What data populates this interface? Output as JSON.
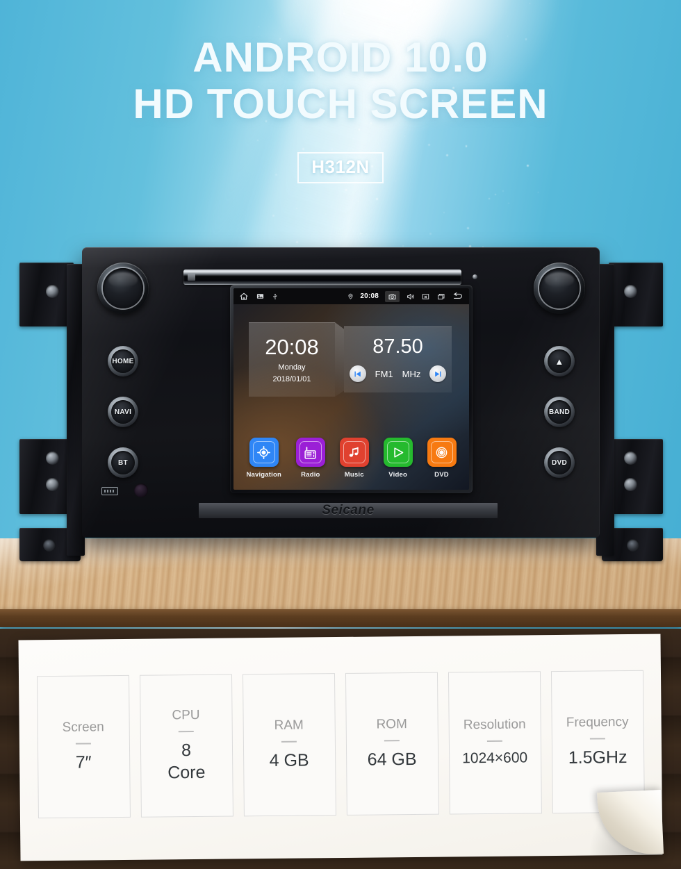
{
  "hero": {
    "line1": "ANDROID 10.0",
    "line2": "HD TOUCH SCREEN",
    "model_badge": "H312N"
  },
  "device": {
    "brand": "Seicane",
    "left_buttons": [
      {
        "name": "volume-knob",
        "label": ""
      },
      {
        "name": "home",
        "label": "HOME"
      },
      {
        "name": "navi",
        "label": "NAVI"
      },
      {
        "name": "bt",
        "label": "BT"
      }
    ],
    "right_buttons": [
      {
        "name": "tune-knob",
        "label": ""
      },
      {
        "name": "eject",
        "label": "▲"
      },
      {
        "name": "band",
        "label": "BAND"
      },
      {
        "name": "dvd",
        "label": "DVD"
      }
    ],
    "screen": {
      "statusbar": {
        "left_icons": [
          "home-icon",
          "image-icon",
          "usb-icon"
        ],
        "location_icon": "location-pin-icon",
        "time": "20:08",
        "right_icons": [
          "camera-icon",
          "volume-icon",
          "close-icon",
          "recents-icon",
          "back-icon"
        ]
      },
      "clock_widget": {
        "time": "20:08",
        "weekday": "Monday",
        "date": "2018/01/01"
      },
      "radio_widget": {
        "frequency": "87.50",
        "band": "FM1",
        "unit": "MHz",
        "prev_label": "prev-station-button",
        "next_label": "next-station-button"
      },
      "apps": [
        {
          "label": "Navigation",
          "color": "#2f86f6",
          "icon": "navigation-target-icon"
        },
        {
          "label": "Radio",
          "color": "#9b1fd6",
          "icon": "radio-icon"
        },
        {
          "label": "Music",
          "color": "#e0412f",
          "icon": "music-note-icon"
        },
        {
          "label": "Video",
          "color": "#25ba2e",
          "icon": "video-play-icon"
        },
        {
          "label": "DVD",
          "color": "#f77a11",
          "icon": "dvd-disc-icon"
        }
      ]
    }
  },
  "specs": [
    {
      "label": "Screen",
      "value": "7″"
    },
    {
      "label": "CPU",
      "value": "8\nCore"
    },
    {
      "label": "RAM",
      "value": "4 GB"
    },
    {
      "label": "ROM",
      "value": "64 GB"
    },
    {
      "label": "Resolution",
      "value": "1024×600"
    },
    {
      "label": "Frequency",
      "value": "1.5GHz"
    }
  ],
  "colors": {
    "sky_light": "#d9f2fa",
    "sky_mid": "#63c0dd",
    "sky_dark": "#45aed3",
    "wood": "#d7b489",
    "paper": "#fbfaf8"
  }
}
